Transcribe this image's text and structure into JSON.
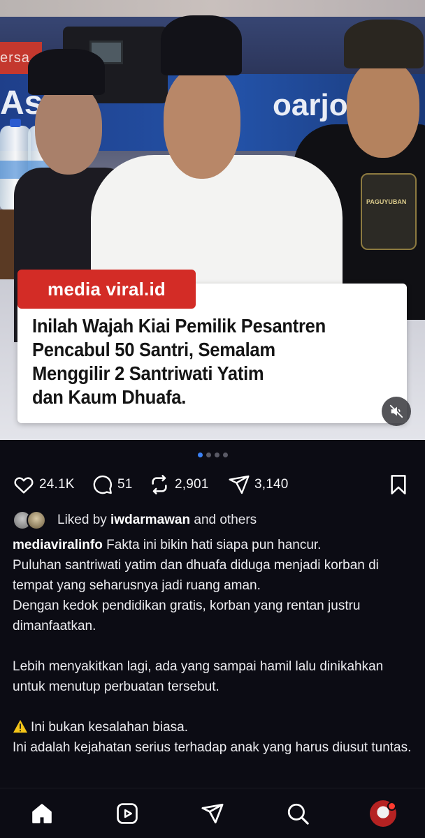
{
  "post_image": {
    "brand_label": "media viral.id",
    "headline_lines": [
      "Inilah Wajah Kiai Pemilik Pesantren",
      "Pencabul 50 Santri, Semalam",
      "Menggilir 2 Santriwati Yatim",
      "dan Kaum Dhuafa."
    ],
    "background_text_left": "ersa",
    "background_text_mid": "As",
    "background_text_right": "oarjo )",
    "badge_text": "PAGUYUBAN",
    "mute_icon": "speaker-muted-icon"
  },
  "carousel": {
    "dot_count": 4,
    "active_index": 0
  },
  "actions": {
    "likes": "24.1K",
    "comments": "51",
    "reposts": "2,901",
    "shares": "3,140"
  },
  "liked_by": {
    "prefix": "Liked by ",
    "username": "iwdarmawan",
    "suffix": " and others"
  },
  "caption": {
    "username": "mediaviralinfo",
    "first_text": " Fakta ini bikin hati siapa pun hancur.",
    "lines": [
      "Puluhan santriwati yatim dan dhuafa diduga menjadi korban di tempat yang seharusnya jadi ruang aman.",
      "Dengan kedok pendidikan gratis, korban yang rentan justru dimanfaatkan."
    ],
    "para2": "Lebih menyakitkan lagi, ada yang sampai hamil lalu dinikahkan untuk menutup perbuatan tersebut.",
    "para3_line1": "Ini bukan kesalahan biasa.",
    "para3_line2": "Ini adalah kejahatan serius terhadap anak yang harus diusut tuntas."
  },
  "nav": {
    "items": [
      "home-icon",
      "reels-icon",
      "send-icon",
      "search-icon",
      "profile-avatar"
    ]
  },
  "colors": {
    "background": "#0c0c14",
    "brand_red": "#d32c26",
    "active_dot": "#3b82f6"
  }
}
